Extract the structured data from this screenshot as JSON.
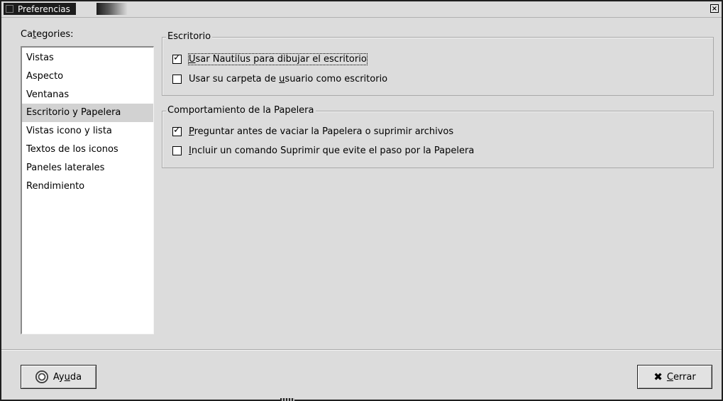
{
  "window": {
    "title": "Preferencias",
    "close_glyph": "×"
  },
  "categories": {
    "label_before": "Ca",
    "label_mnemonic": "t",
    "label_after": "egories:",
    "items": [
      {
        "label": "Vistas",
        "selected": false
      },
      {
        "label": "Aspecto",
        "selected": false
      },
      {
        "label": "Ventanas",
        "selected": false
      },
      {
        "label": "Escritorio y Papelera",
        "selected": true
      },
      {
        "label": "Vistas icono y lista",
        "selected": false
      },
      {
        "label": "Textos de los iconos",
        "selected": false
      },
      {
        "label": "Paneles laterales",
        "selected": false
      },
      {
        "label": "Rendimiento",
        "selected": false
      }
    ]
  },
  "escritorio": {
    "title": "Escritorio",
    "option1": {
      "mnemonic": "U",
      "rest": "sar Nautilus para dibujar el escritorio",
      "checked": true
    },
    "option2": {
      "before": "Usar su carpeta de ",
      "mnemonic": "u",
      "rest": "suario como escritorio",
      "checked": false
    }
  },
  "papelera": {
    "title": "Comportamiento de la Papelera",
    "option1": {
      "mnemonic": "P",
      "rest": "reguntar antes de vaciar la Papelera o suprimir archivos",
      "checked": true
    },
    "option2": {
      "mnemonic": "I",
      "rest": "ncluir un comando Suprimir que evite el paso por la Papelera",
      "checked": false
    }
  },
  "buttons": {
    "help": {
      "before": "Ay",
      "mnemonic": "u",
      "after": "da",
      "icon": "help-lifebuoy-icon"
    },
    "close": {
      "mnemonic": "C",
      "after": "errar",
      "icon": "close-x-icon",
      "glyph": "✖"
    }
  },
  "checkmark": "✓",
  "colors": {
    "window_bg": "#dcdcdc",
    "selection_bg": "#d2d2d2",
    "title_bg": "#1c1c1c"
  }
}
